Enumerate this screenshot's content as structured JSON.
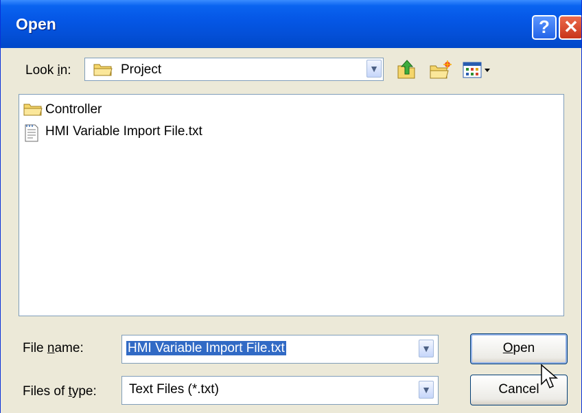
{
  "window": {
    "title": "Open"
  },
  "titlebar": {
    "help_glyph": "?",
    "close_glyph": "✕"
  },
  "look_in": {
    "label_prefix": "Look ",
    "label_mnemonic": "i",
    "label_suffix": "n:",
    "value": "Project",
    "icon": "folder-icon"
  },
  "toolbar": {
    "icons": [
      "up-one-level-icon",
      "create-new-folder-icon",
      "view-menu-icon"
    ]
  },
  "files": [
    {
      "name": "Controller",
      "type": "folder",
      "icon": "folder-icon"
    },
    {
      "name": "HMI Variable Import File.txt",
      "type": "text-file",
      "icon": "text-file-icon"
    }
  ],
  "file_name": {
    "label_prefix": "File ",
    "label_mnemonic": "n",
    "label_suffix": "ame:",
    "value": "HMI Variable Import File.txt"
  },
  "files_of_type": {
    "label_prefix": "Files of ",
    "label_mnemonic": "t",
    "label_suffix": "ype:",
    "value": "Text Files (*.txt)"
  },
  "buttons": {
    "open_mnemonic": "O",
    "open_rest": "pen",
    "cancel": "Cancel"
  },
  "colors": {
    "titlebar": "#0a5fe6",
    "selection": "#316ac5",
    "dialog_bg": "#ece9d8"
  }
}
